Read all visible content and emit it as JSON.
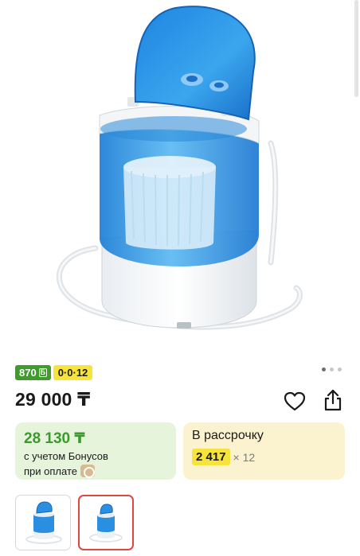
{
  "product_image": {
    "alt": "Mini washing machine, blue and white"
  },
  "badges": {
    "bonus": "870",
    "bonus_icon": "Б",
    "installment": "0·0·12"
  },
  "pagination": {
    "pages": 3,
    "active": 0
  },
  "price": "29 000 ₸",
  "actions": {
    "favorite_icon": "heart-icon",
    "share_icon": "share-icon"
  },
  "bonus_card": {
    "price": "28 130 ₸",
    "line1": "с учетом Бонусов",
    "line2": "при оплате"
  },
  "installment_card": {
    "title": "В рассрочку",
    "amount": "2 417",
    "multiplier": "× 12"
  },
  "thumbnails": [
    {
      "selected": false
    },
    {
      "selected": true
    }
  ],
  "colors": {
    "bonus_green": "#3e9b2c",
    "installment_yellow": "#f6e33b",
    "selected_border": "#e0473f",
    "tub_blue": "#2a8fe0"
  }
}
